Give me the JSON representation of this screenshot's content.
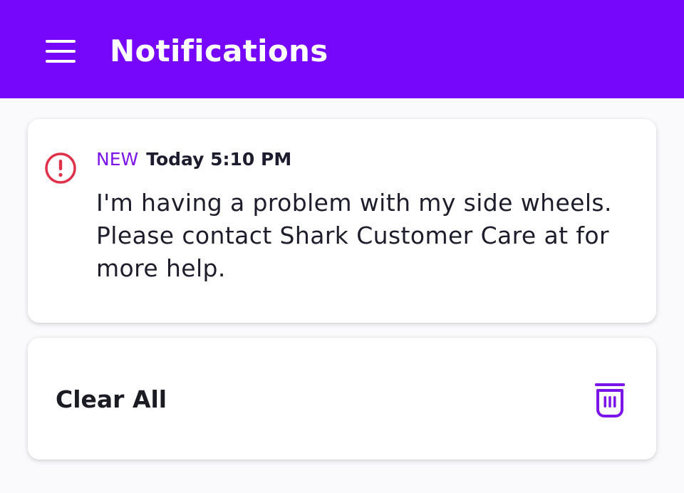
{
  "header": {
    "title": "Notifications",
    "menu_icon": "hamburger-menu-icon",
    "background_color": "#7607FA"
  },
  "notifications": [
    {
      "status_icon": "alert-circle-icon",
      "status_color": "#E0314B",
      "badge": "NEW",
      "badge_color": "#7B14E8",
      "timestamp": "Today 5:10 PM",
      "message": "I'm having a problem with my side wheels. Please contact Shark Customer Care at for more help."
    }
  ],
  "clear_all": {
    "label": "Clear All",
    "icon": "trash-icon",
    "icon_color": "#7B14E8"
  }
}
